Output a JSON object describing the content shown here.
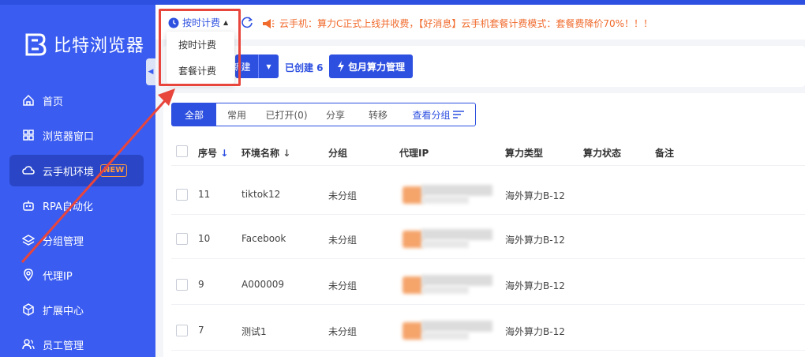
{
  "app": {
    "name": "比特浏览器",
    "brand_color": "#3a5cf0",
    "accent_color": "#2e50e0",
    "highlight_color": "#e8453c"
  },
  "sidebar": {
    "items": [
      {
        "label": "首页",
        "icon": "home-icon"
      },
      {
        "label": "浏览器窗口",
        "icon": "grid-icon"
      },
      {
        "label": "云手机环境",
        "icon": "cloud-icon",
        "badge": "NEW",
        "active": true
      },
      {
        "label": "RPA自动化",
        "icon": "robot-icon"
      },
      {
        "label": "分组管理",
        "icon": "layers-icon"
      },
      {
        "label": "代理IP",
        "icon": "location-icon"
      },
      {
        "label": "扩展中心",
        "icon": "cube-icon"
      },
      {
        "label": "员工管理",
        "icon": "users-icon"
      }
    ]
  },
  "topbar": {
    "billing_label": "按时计费",
    "notice": "云手机：算力C正式上线并收费，【好消息】云手机套餐计费模式：套餐费降价70%！！！"
  },
  "billing_dropdown": {
    "options": [
      "按时计费",
      "套餐计费"
    ]
  },
  "actions": {
    "create_label": "新建",
    "created_label": "已创建 6",
    "monthly_label": "包月算力管理"
  },
  "tabs": [
    {
      "label": "全部",
      "active": true
    },
    {
      "label": "常用"
    },
    {
      "label": "已打开(0)"
    },
    {
      "label": "分享"
    },
    {
      "label": "转移"
    },
    {
      "label": "查看分组"
    }
  ],
  "table": {
    "headers": [
      "序号",
      "环境名称",
      "分组",
      "代理IP",
      "算力类型",
      "算力状态",
      "备注"
    ],
    "rows": [
      {
        "seq": "11",
        "name": "tiktok12",
        "group": "未分组",
        "compute": "海外算力B-12"
      },
      {
        "seq": "10",
        "name": "Facebook",
        "group": "未分组",
        "compute": "海外算力B-12"
      },
      {
        "seq": "9",
        "name": "A000009",
        "group": "未分组",
        "compute": "海外算力B-12"
      },
      {
        "seq": "7",
        "name": "测试1",
        "group": "未分组",
        "compute": "海外算力B-12"
      }
    ]
  }
}
